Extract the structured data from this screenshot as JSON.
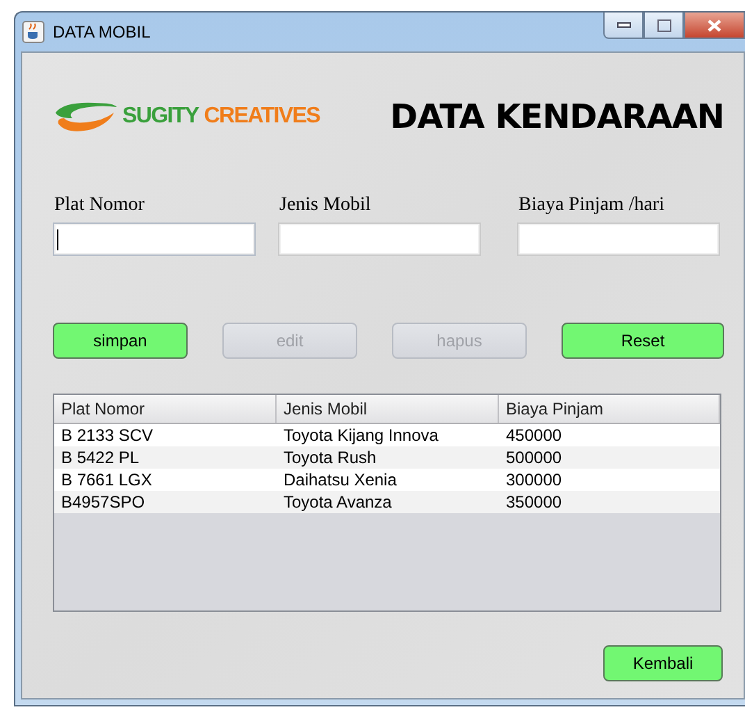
{
  "window": {
    "title": "DATA MOBIL"
  },
  "logo": {
    "word_1": "SUGITY",
    "word_2": "CREATIVES"
  },
  "heading": "DATA KENDARAAN",
  "fields": [
    {
      "label": "Plat Nomor",
      "focused": true
    },
    {
      "label": "Jenis Mobil",
      "focused": false
    },
    {
      "label": "Biaya Pinjam /hari",
      "focused": false
    }
  ],
  "buttons": [
    {
      "label": "simpan",
      "disabled": false
    },
    {
      "label": "edit",
      "disabled": true
    },
    {
      "label": "hapus",
      "disabled": true
    },
    {
      "label": "Reset",
      "disabled": false
    }
  ],
  "table": {
    "columns": [
      "Plat Nomor",
      "Jenis Mobil",
      "Biaya Pinjam"
    ],
    "rows": [
      [
        "B 2133 SCV",
        "Toyota Kijang Innova",
        "450000"
      ],
      [
        "B 5422 PL",
        "Toyota Rush",
        "500000"
      ],
      [
        "B 7661 LGX",
        "Daihatsu Xenia",
        "300000"
      ],
      [
        "B4957SPO",
        "Toyota Avanza",
        "350000"
      ]
    ]
  },
  "back_button": {
    "label": "Kembali"
  }
}
